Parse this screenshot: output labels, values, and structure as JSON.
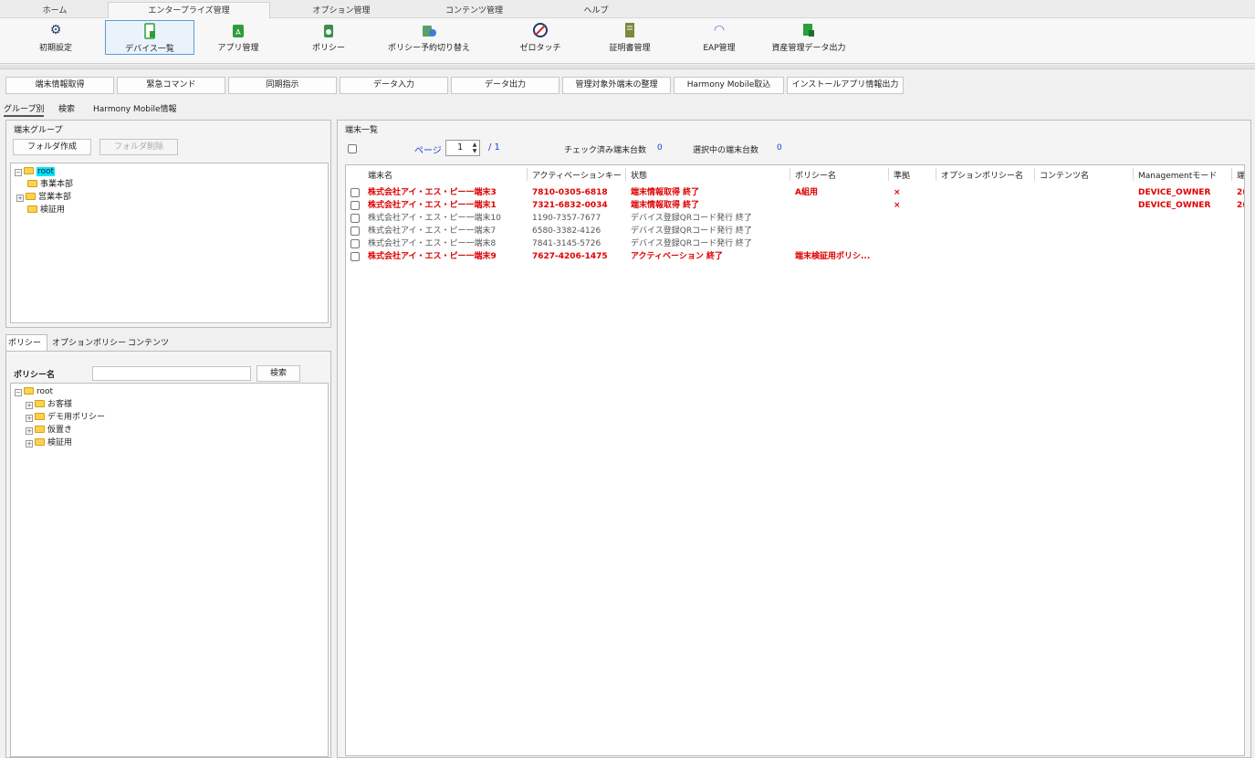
{
  "ribbon_tabs": [
    "ホーム",
    "エンタープライズ管理",
    "オプション管理",
    "コンテンツ管理",
    "ヘルプ"
  ],
  "ribbon_buttons": [
    {
      "label": "初期設定",
      "icon": "gear-icon"
    },
    {
      "label": "デバイス一覧",
      "icon": "device-list-icon"
    },
    {
      "label": "アプリ管理",
      "icon": "app-icon"
    },
    {
      "label": "ポリシー",
      "icon": "policy-icon"
    },
    {
      "label": "ポリシー予約切り替え",
      "icon": "schedule-icon"
    },
    {
      "label": "ゼロタッチ",
      "icon": "zero-touch-icon"
    },
    {
      "label": "証明書管理",
      "icon": "certificate-icon"
    },
    {
      "label": "EAP管理",
      "icon": "wifi-icon"
    },
    {
      "label": "資産管理データ出力",
      "icon": "export-icon"
    }
  ],
  "commands": [
    "端末情報取得",
    "緊急コマンド",
    "同期指示",
    "データ入力",
    "データ出力",
    "管理対象外端末の整理",
    "Harmony Mobile取込",
    "インストールアプリ情報出力"
  ],
  "left_tabs": [
    "グループ別",
    "検索",
    "Harmony Mobile情報"
  ],
  "group_panel": {
    "title": "端末グループ",
    "create_folder": "フォルダ作成",
    "delete_folder": "フォルダ削除",
    "tree": {
      "root": "root",
      "children": [
        "事業本部",
        "営業本部",
        "検証用"
      ]
    }
  },
  "policy_panel": {
    "tabs": [
      "ポリシー",
      "オプションポリシー",
      "コンテンツ"
    ],
    "name_label": "ポリシー名",
    "search_value": "",
    "search_button": "検索",
    "tree": {
      "root": "root",
      "children": [
        "お客様",
        "デモ用ポリシー",
        "仮置き",
        "検証用"
      ]
    }
  },
  "device_list": {
    "title": "端末一覧",
    "page_label": "ページ",
    "page_value": "1",
    "page_total": "/ 1",
    "checked_label": "チェック済み端末台数",
    "checked_count": "0",
    "selected_label": "選択中の端末台数",
    "selected_count": "0",
    "columns": [
      "端末名",
      "アクティベーションキー",
      "状態",
      "ポリシー名",
      "準拠",
      "オプションポリシー名",
      "コンテンツ名",
      "Managementモード",
      "端"
    ],
    "rows": [
      {
        "name": "株式会社アイ・エス・ピー一端末3",
        "key": "7810-0305-6818",
        "status": "端末情報取得 終了",
        "policy": "A組用",
        "compliant": "×",
        "mode": "DEVICE_OWNER",
        "extra": "2(",
        "style": "red"
      },
      {
        "name": "株式会社アイ・エス・ピー一端末1",
        "key": "7321-6832-0034",
        "status": "端末情報取得 終了",
        "policy": "",
        "compliant": "×",
        "mode": "DEVICE_OWNER",
        "extra": "2(",
        "style": "red"
      },
      {
        "name": "株式会社アイ・エス・ピー一端末10",
        "key": "1190-7357-7677",
        "status": "デバイス登録QRコード発行 終了",
        "policy": "",
        "compliant": "",
        "mode": "",
        "extra": "",
        "style": "gray"
      },
      {
        "name": "株式会社アイ・エス・ピー一端末7",
        "key": "6580-3382-4126",
        "status": "デバイス登録QRコード発行 終了",
        "policy": "",
        "compliant": "",
        "mode": "",
        "extra": "",
        "style": "gray"
      },
      {
        "name": "株式会社アイ・エス・ピー一端末8",
        "key": "7841-3145-5726",
        "status": "デバイス登録QRコード発行 終了",
        "policy": "",
        "compliant": "",
        "mode": "",
        "extra": "",
        "style": "gray"
      },
      {
        "name": "株式会社アイ・エス・ピー一端末9",
        "key": "7627-4206-1475",
        "status": "アクティベーション 終了",
        "policy": "端末検証用ポリシ...",
        "compliant": "",
        "mode": "",
        "extra": "",
        "style": "red"
      }
    ]
  },
  "colors": {
    "selected_root": "#00e5ff",
    "error_red": "#e00000",
    "link_blue": "#1a3fd6",
    "active_button_border": "#5b9bd5"
  }
}
